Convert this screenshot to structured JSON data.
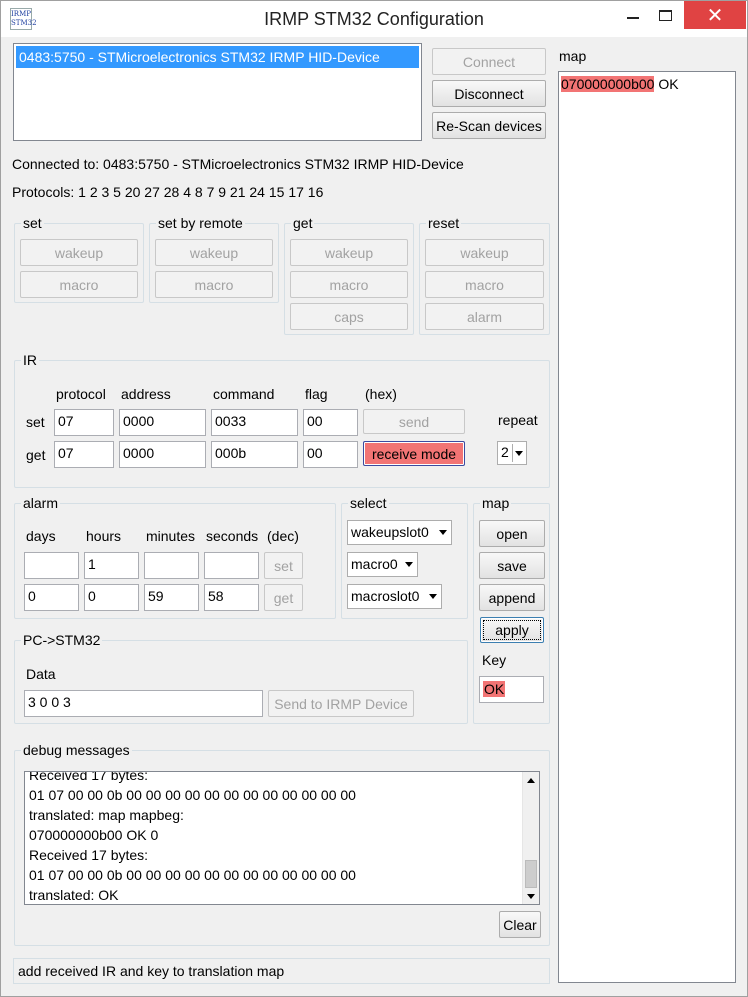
{
  "window": {
    "title": "IRMP STM32 Configuration",
    "icon_text": "IRMP STM32",
    "close_glyph": "✕"
  },
  "devices": {
    "items": [
      "0483:5750 - STMicroelectronics STM32 IRMP HID-Device"
    ],
    "connect_label": "Connect",
    "disconnect_label": "Disconnect",
    "rescan_label": "Re-Scan devices"
  },
  "status": {
    "connected": "Connected to: 0483:5750 - STMicroelectronics STM32 IRMP HID-Device",
    "protocols": "Protocols: 1 2 3 5 20 27 28 4 8 7 9 21 24 15 17 16"
  },
  "groups": {
    "set": {
      "title": "set",
      "wakeup": "wakeup",
      "macro": "macro"
    },
    "set_by_remote": {
      "title": "set by remote",
      "wakeup": "wakeup",
      "macro": "macro"
    },
    "get": {
      "title": "get",
      "wakeup": "wakeup",
      "macro": "macro",
      "caps": "caps"
    },
    "reset": {
      "title": "reset",
      "wakeup": "wakeup",
      "macro": "macro",
      "alarm": "alarm"
    }
  },
  "ir": {
    "title": "IR",
    "headers": {
      "protocol": "protocol",
      "address": "address",
      "command": "command",
      "flag": "flag",
      "hex": "(hex)"
    },
    "set_row": {
      "label": "set",
      "protocol": "07",
      "address": "0000",
      "command": "0033",
      "flag": "00",
      "button": "send"
    },
    "get_row": {
      "label": "get",
      "protocol": "07",
      "address": "0000",
      "command": "000b",
      "flag": "00",
      "button": "receive mode"
    },
    "repeat_label": "repeat",
    "repeat_value": "2"
  },
  "alarm": {
    "title": "alarm",
    "headers": {
      "days": "days",
      "hours": "hours",
      "minutes": "minutes",
      "seconds": "seconds",
      "dec": "(dec)"
    },
    "set_row": {
      "days": "",
      "hours": "1",
      "minutes": "",
      "seconds": "",
      "button": "set"
    },
    "get_row": {
      "days": "0",
      "hours": "0",
      "minutes": "59",
      "seconds": "58",
      "button": "get"
    }
  },
  "select": {
    "title": "select",
    "wakeup": "wakeupslot0",
    "macro": "macro0",
    "macroslot": "macroslot0"
  },
  "map_group": {
    "title": "map",
    "open": "open",
    "save": "save",
    "append": "append",
    "apply": "apply",
    "key_label": "Key",
    "key_value": "OK"
  },
  "pc_stm32": {
    "title": "PC->STM32",
    "data_label": "Data",
    "data_value": "3 0 0 3",
    "send_label": "Send to IRMP Device"
  },
  "debug": {
    "title": "debug messages",
    "lines": [
      "Received 17 bytes:",
      "01 07 00 00 0b 00 00 00 00 00 00 00 00 00 00 00 00",
      "translated: map mapbeg:",
      "070000000b00 OK 0",
      "Received 17 bytes:",
      "01 07 00 00 0b 00 00 00 00 00 00 00 00 00 00 00 00",
      "translated: OK"
    ],
    "clear_label": "Clear"
  },
  "statusbar": {
    "text": "add received IR and key to translation map"
  },
  "map_panel": {
    "title": "map",
    "entries": [
      {
        "code": "070000000b00",
        "key": "OK"
      }
    ]
  },
  "colors": {
    "selection": "#3399ff",
    "highlight_red": "#f27474",
    "close_red": "#e04343"
  }
}
